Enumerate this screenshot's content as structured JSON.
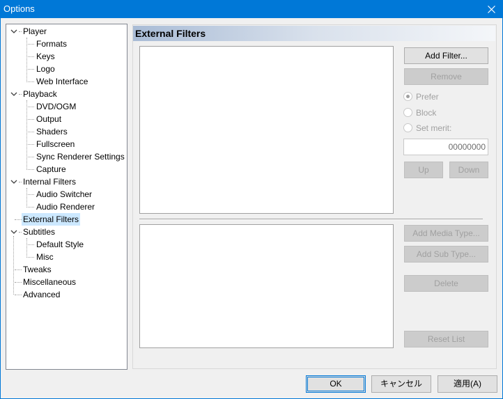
{
  "window": {
    "title": "Options"
  },
  "tree": {
    "items": [
      {
        "label": "Player",
        "level": 0,
        "expandable": true
      },
      {
        "label": "Formats",
        "level": 1
      },
      {
        "label": "Keys",
        "level": 1
      },
      {
        "label": "Logo",
        "level": 1
      },
      {
        "label": "Web Interface",
        "level": 1
      },
      {
        "label": "Playback",
        "level": 0,
        "expandable": true
      },
      {
        "label": "DVD/OGM",
        "level": 1
      },
      {
        "label": "Output",
        "level": 1
      },
      {
        "label": "Shaders",
        "level": 1
      },
      {
        "label": "Fullscreen",
        "level": 1
      },
      {
        "label": "Sync Renderer Settings",
        "level": 1
      },
      {
        "label": "Capture",
        "level": 1
      },
      {
        "label": "Internal Filters",
        "level": 0,
        "expandable": true
      },
      {
        "label": "Audio Switcher",
        "level": 1
      },
      {
        "label": "Audio Renderer",
        "level": 1
      },
      {
        "label": "External Filters",
        "level": 0,
        "selected": true
      },
      {
        "label": "Subtitles",
        "level": 0,
        "expandable": true
      },
      {
        "label": "Default Style",
        "level": 1
      },
      {
        "label": "Misc",
        "level": 1
      },
      {
        "label": "Tweaks",
        "level": 0
      },
      {
        "label": "Miscellaneous",
        "level": 0
      },
      {
        "label": "Advanced",
        "level": 0
      }
    ]
  },
  "panel": {
    "title": "External Filters",
    "add_filter": "Add Filter...",
    "remove": "Remove",
    "prefer": "Prefer",
    "block": "Block",
    "set_merit": "Set merit:",
    "merit_value": "00000000",
    "up": "Up",
    "down": "Down",
    "add_media_type": "Add Media Type...",
    "add_sub_type": "Add Sub Type...",
    "delete": "Delete",
    "reset_list": "Reset List"
  },
  "footer": {
    "ok": "OK",
    "cancel": "キャンセル",
    "apply": "適用(A)"
  }
}
